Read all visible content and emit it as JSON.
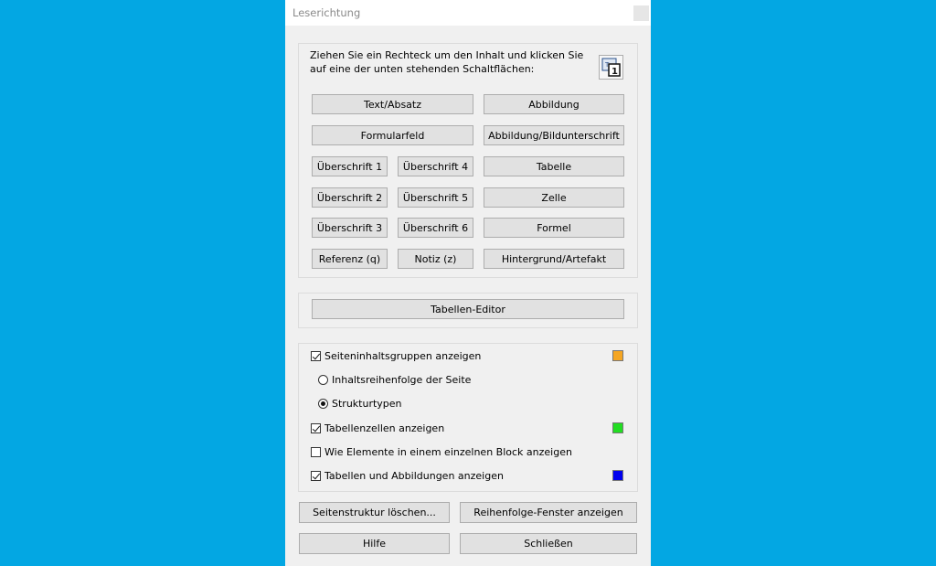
{
  "window": {
    "title": "Leserichtung"
  },
  "instructions": "Ziehen Sie ein Rechteck um den Inhalt und klicken Sie auf eine der unten stehenden Schaltflächen:",
  "tag_buttons": {
    "text_absatz": "Text/Absatz",
    "abbildung": "Abbildung",
    "formularfeld": "Formularfeld",
    "abbildung_bildunterschrift": "Abbildung/Bildunterschrift",
    "ueberschrift1": "Überschrift 1",
    "ueberschrift4": "Überschrift 4",
    "tabelle": "Tabelle",
    "ueberschrift2": "Überschrift 2",
    "ueberschrift5": "Überschrift 5",
    "zelle": "Zelle",
    "ueberschrift3": "Überschrift 3",
    "ueberschrift6": "Überschrift 6",
    "formel": "Formel",
    "referenz": "Referenz (q)",
    "notiz": "Notiz (z)",
    "hintergrund": "Hintergrund/Artefakt"
  },
  "table_editor_label": "Tabellen-Editor",
  "options": {
    "show_content_groups": {
      "label": "Seiteninhaltsgruppen anzeigen",
      "checked": true,
      "color": "#f5a623"
    },
    "page_content_order": {
      "label": "Inhaltsreihenfolge der Seite",
      "selected": false
    },
    "structure_types": {
      "label": "Strukturtypen",
      "selected": true
    },
    "show_table_cells": {
      "label": "Tabellenzellen anzeigen",
      "checked": true,
      "color": "#22dd22"
    },
    "show_single_block": {
      "label": "Wie Elemente in einem einzelnen Block anzeigen",
      "checked": false
    },
    "show_tables_figures": {
      "label": "Tabellen und Abbildungen anzeigen",
      "checked": true,
      "color": "#0000ee"
    }
  },
  "bottom_buttons": {
    "clear_structure": "Seitenstruktur löschen...",
    "show_order_window": "Reihenfolge-Fenster anzeigen",
    "help": "Hilfe",
    "close": "Schließen"
  }
}
